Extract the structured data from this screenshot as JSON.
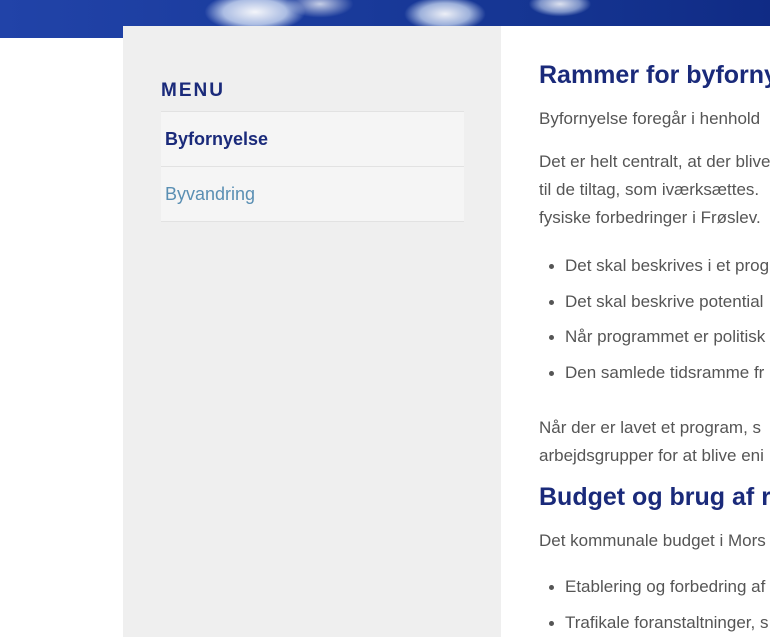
{
  "sidebar": {
    "heading": "MENU",
    "items": [
      {
        "label": "Byfornyelse",
        "active": true
      },
      {
        "label": "Byvandring",
        "active": false
      }
    ]
  },
  "content": {
    "section1": {
      "heading": "Rammer for byforny",
      "intro": "Byfornyelse foregår i henhold",
      "para2_lines": [
        "Det er helt centralt, at der blive",
        "til de tiltag, som iværksættes.",
        "fysiske forbedringer i Frøslev."
      ],
      "bullets": [
        "Det skal beskrives i et prog",
        "Det skal beskrive potential",
        "Når programmet er politisk",
        "Den samlede tidsramme fr"
      ],
      "para3_lines": [
        "Når der er lavet et program, s",
        "arbejdsgrupper for at blive eni"
      ]
    },
    "section2": {
      "heading": "Budget og brug af r",
      "intro": "Det kommunale budget i Mors",
      "bullets": [
        "Etablering og forbedring af",
        "Trafikale foranstaltninger, s"
      ]
    }
  },
  "colors": {
    "heading": "#1a2a7a",
    "active_menu": "#1a2a7a",
    "inactive_menu": "#5a8fb3",
    "body_text": "#555555",
    "sidebar_bg": "#efefef",
    "banner_blue": "#1b3c9e"
  }
}
